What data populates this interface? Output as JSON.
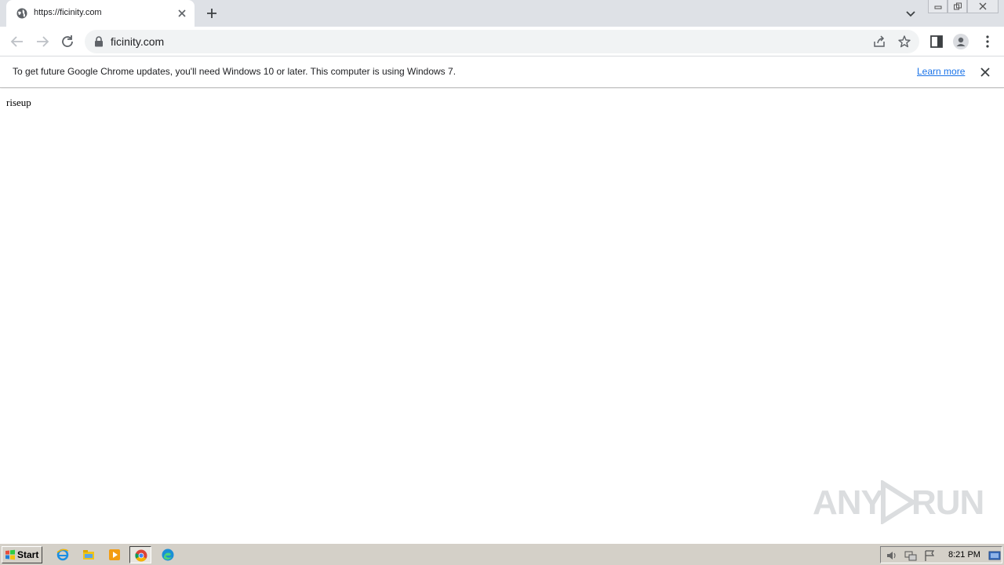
{
  "tab": {
    "title": "https://ficinity.com"
  },
  "omnibox": {
    "url": "ficinity.com"
  },
  "infobar": {
    "message": "To get future Google Chrome updates, you'll need Windows 10 or later. This computer is using Windows 7.",
    "link": "Learn more"
  },
  "page": {
    "text": "riseup"
  },
  "watermark": {
    "left": "ANY",
    "right": "RUN"
  },
  "taskbar": {
    "start_label": "Start",
    "apps": [
      "ie-icon",
      "explorer-icon",
      "media-player-icon",
      "chrome-icon",
      "edge-icon"
    ],
    "clock": "8:21 PM"
  },
  "colors": {
    "tabstrip": "#dee1e6",
    "omnibox": "#f1f3f4",
    "link": "#1a73e8",
    "taskbar": "#d4d0c8"
  }
}
